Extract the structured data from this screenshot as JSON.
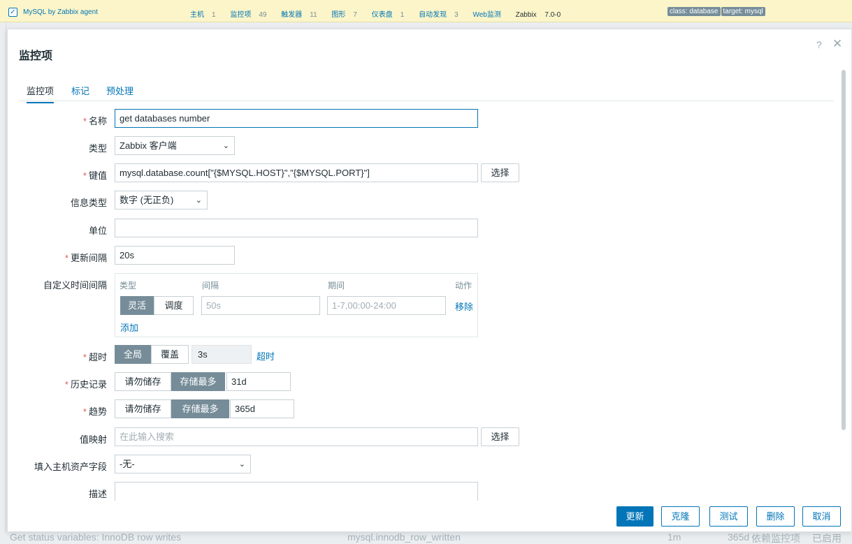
{
  "background": {
    "template_name": "MySQL by Zabbix agent",
    "links": [
      {
        "label": "主机",
        "count": "1"
      },
      {
        "label": "监控项",
        "count": "49"
      },
      {
        "label": "触发器",
        "count": "11"
      },
      {
        "label": "图形",
        "count": "7"
      },
      {
        "label": "仪表盘",
        "count": "1"
      },
      {
        "label": "自动发现",
        "count": "3"
      },
      {
        "label": "Web监测",
        "count": ""
      }
    ],
    "vendor": "Zabbix",
    "version": "7.0-0",
    "tags": [
      "class: database",
      "target: mysql"
    ],
    "bottom_row": [
      "Get status variables: InnoDB row writes",
      "mysql.innodb_row_written",
      "1m",
      "365d",
      "依赖监控项",
      "已启用"
    ]
  },
  "dialog": {
    "title": "监控项",
    "help": "?",
    "close": "✕",
    "tabs": [
      "监控项",
      "标记",
      "预处理"
    ],
    "form": {
      "name": {
        "label": "名称",
        "value": "get databases number"
      },
      "type": {
        "label": "类型",
        "value": "Zabbix 客户端"
      },
      "key": {
        "label": "键值",
        "value": "mysql.database.count[\"{$MYSQL.HOST}\",\"{$MYSQL.PORT}\"]",
        "select": "选择"
      },
      "info_type": {
        "label": "信息类型",
        "value": "数字 (无正负)"
      },
      "units": {
        "label": "单位",
        "value": ""
      },
      "update_interval": {
        "label": "更新间隔",
        "value": "20s"
      },
      "custom_intervals": {
        "label": "自定义时间间隔",
        "headers": [
          "类型",
          "间隔",
          "期间",
          "动作"
        ],
        "flexible": "灵活",
        "scheduling": "调度",
        "interval_placeholder": "50s",
        "period_placeholder": "1-7,00:00-24:00",
        "remove": "移除",
        "add": "添加"
      },
      "timeout": {
        "label": "超时",
        "global": "全局",
        "override": "覆盖",
        "value": "3s",
        "link": "超时"
      },
      "history": {
        "label": "历史记录",
        "no_store": "请勿储存",
        "store_up_to": "存储最多",
        "value": "31d"
      },
      "trends": {
        "label": "趋势",
        "no_store": "请勿储存",
        "store_up_to": "存储最多",
        "value": "365d"
      },
      "value_map": {
        "label": "值映射",
        "placeholder": "在此输入搜索",
        "select": "选择"
      },
      "inventory": {
        "label": "填入主机资产字段",
        "value": "-无-"
      },
      "description": {
        "label": "描述",
        "value": ""
      }
    },
    "buttons": {
      "update": "更新",
      "clone": "克隆",
      "test": "测试",
      "delete": "删除",
      "cancel": "取消"
    }
  },
  "colors": {
    "accent": "#0275b8",
    "segment_active": "#768d99",
    "required": "#e45959",
    "topbar": "#fbf5c9"
  }
}
